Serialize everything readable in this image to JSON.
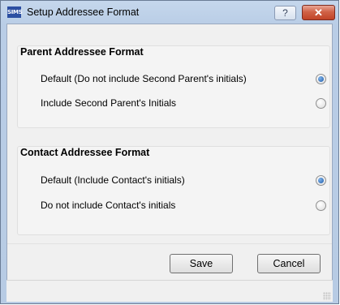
{
  "window": {
    "title": "Setup Addressee Format",
    "app_icon_text": "SIMS",
    "help_label": "?",
    "close_label": "✕"
  },
  "parent_group": {
    "title": "Parent Addressee Format",
    "options": [
      {
        "label": "Default (Do not include Second Parent's initials)",
        "selected": true
      },
      {
        "label": "Include Second Parent's Initials",
        "selected": false
      }
    ]
  },
  "contact_group": {
    "title": "Contact Addressee Format",
    "options": [
      {
        "label": "Default (Include Contact's initials)",
        "selected": true
      },
      {
        "label": "Do not include Contact's initials",
        "selected": false
      }
    ]
  },
  "buttons": {
    "save_label": "Save",
    "cancel_label": "Cancel"
  },
  "colors": {
    "titlebar": "#c5d7ec",
    "close_button": "#c14327",
    "radio_checked": "#1d5aa8"
  }
}
